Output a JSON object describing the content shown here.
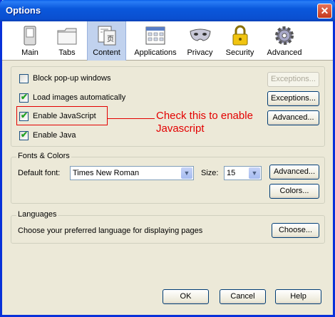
{
  "window": {
    "title": "Options",
    "close_glyph": "✕"
  },
  "tabs": [
    {
      "label": "Main",
      "icon": "switch-icon"
    },
    {
      "label": "Tabs",
      "icon": "tabs-folder-icon"
    },
    {
      "label": "Content",
      "icon": "content-page-icon",
      "selected": true
    },
    {
      "label": "Applications",
      "icon": "applications-icon"
    },
    {
      "label": "Privacy",
      "icon": "mask-icon"
    },
    {
      "label": "Security",
      "icon": "padlock-icon"
    },
    {
      "label": "Advanced",
      "icon": "gear-icon"
    }
  ],
  "content": {
    "block_popups": {
      "label": "Block pop-up windows",
      "checked": false
    },
    "load_images": {
      "label": "Load images automatically",
      "checked": true
    },
    "enable_js": {
      "label": "Enable JavaScript",
      "checked": true
    },
    "enable_java": {
      "label": "Enable Java",
      "checked": true
    },
    "exceptions_disabled": "Exceptions...",
    "exceptions": "Exceptions...",
    "advanced": "Advanced..."
  },
  "annotation": {
    "line1": "Check this to enable",
    "line2": "Javascript"
  },
  "fonts": {
    "group_label": "Fonts & Colors",
    "default_font_label": "Default font:",
    "default_font_value": "Times New Roman",
    "size_label": "Size:",
    "size_value": "15",
    "advanced": "Advanced...",
    "colors": "Colors..."
  },
  "languages": {
    "group_label": "Languages",
    "description": "Choose your preferred language for displaying pages",
    "choose": "Choose..."
  },
  "footer": {
    "ok": "OK",
    "cancel": "Cancel",
    "help": "Help"
  },
  "colors": {
    "accent": "#0a58dc",
    "annotation": "#e30000",
    "face": "#ece9d8"
  }
}
